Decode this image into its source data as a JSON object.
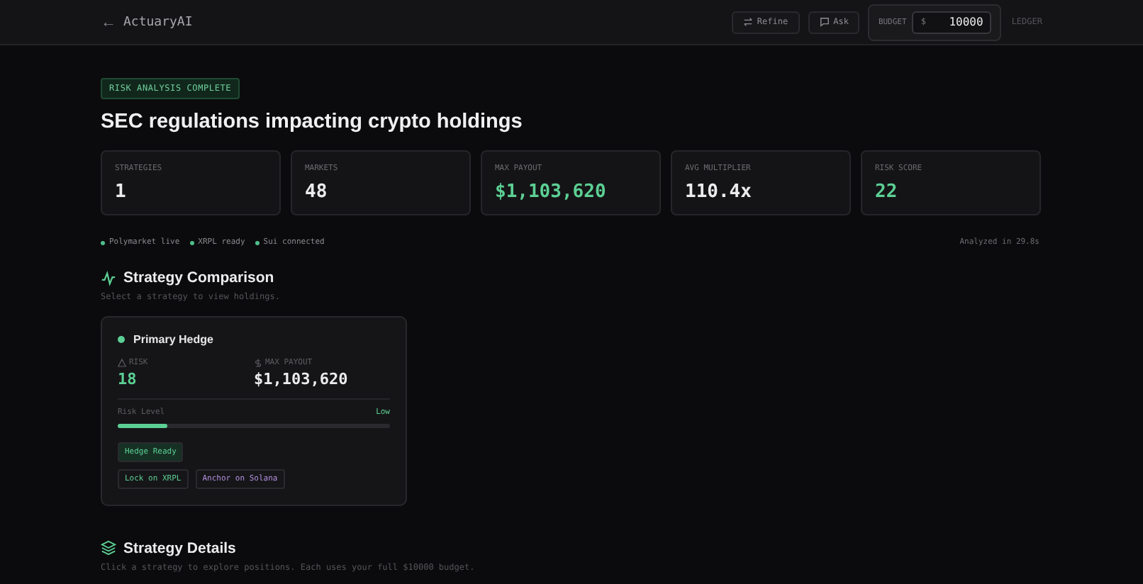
{
  "header": {
    "back_icon": "←",
    "app_name": "ActuaryAI",
    "buttons": [
      {
        "label": "Refine",
        "kind": "refine"
      },
      {
        "label": "Ask",
        "kind": "ask"
      }
    ],
    "budget": {
      "label": "BUDGET",
      "currency": "$",
      "value": "10000"
    },
    "ledger": "LEDGER"
  },
  "status_badge": "RISK ANALYSIS COMPLETE",
  "title": "SEC regulations impacting crypto holdings",
  "stats": [
    {
      "label": "STRATEGIES",
      "value": "1",
      "highlight": false
    },
    {
      "label": "MARKETS",
      "value": "48",
      "highlight": false
    },
    {
      "label": "MAX PAYOUT",
      "value": "$1,103,620",
      "highlight": true
    },
    {
      "label": "AVG MULTIPLIER",
      "value": "110.4x",
      "highlight": false
    },
    {
      "label": "RISK SCORE",
      "value": "22",
      "highlight": true
    }
  ],
  "connections": [
    {
      "label": "Polymarket live",
      "color": "#4fbf8a"
    },
    {
      "label": "XRPL ready",
      "color": "#4fbf8a"
    },
    {
      "label": "Sui connected",
      "color": "#4fbf8a"
    }
  ],
  "analyzed": "Analyzed in 29.8s",
  "comparison": {
    "title": "Strategy Comparison",
    "subtitle": "Select a strategy to view holdings.",
    "card": {
      "name": "Primary Hedge",
      "color": "#5ccf94",
      "risk_label": "RISK",
      "risk": "18",
      "payout_label": "MAX PAYOUT",
      "payout": "$1,103,620",
      "risk_level_label": "Risk Level",
      "risk_level_value": "Low",
      "level": 0.18,
      "tags": [
        [
          {
            "label": "Hedge Ready",
            "color": "#5ccf94"
          }
        ],
        [
          {
            "label": "Lock on XRPL",
            "color": "#5ccf94"
          },
          {
            "label": "Anchor on Solana",
            "color": "#b48ee0"
          }
        ]
      ]
    }
  },
  "details": {
    "title": "Strategy Details",
    "subtitle": "Click a strategy to explore positions. Each uses your full $10000 budget."
  }
}
